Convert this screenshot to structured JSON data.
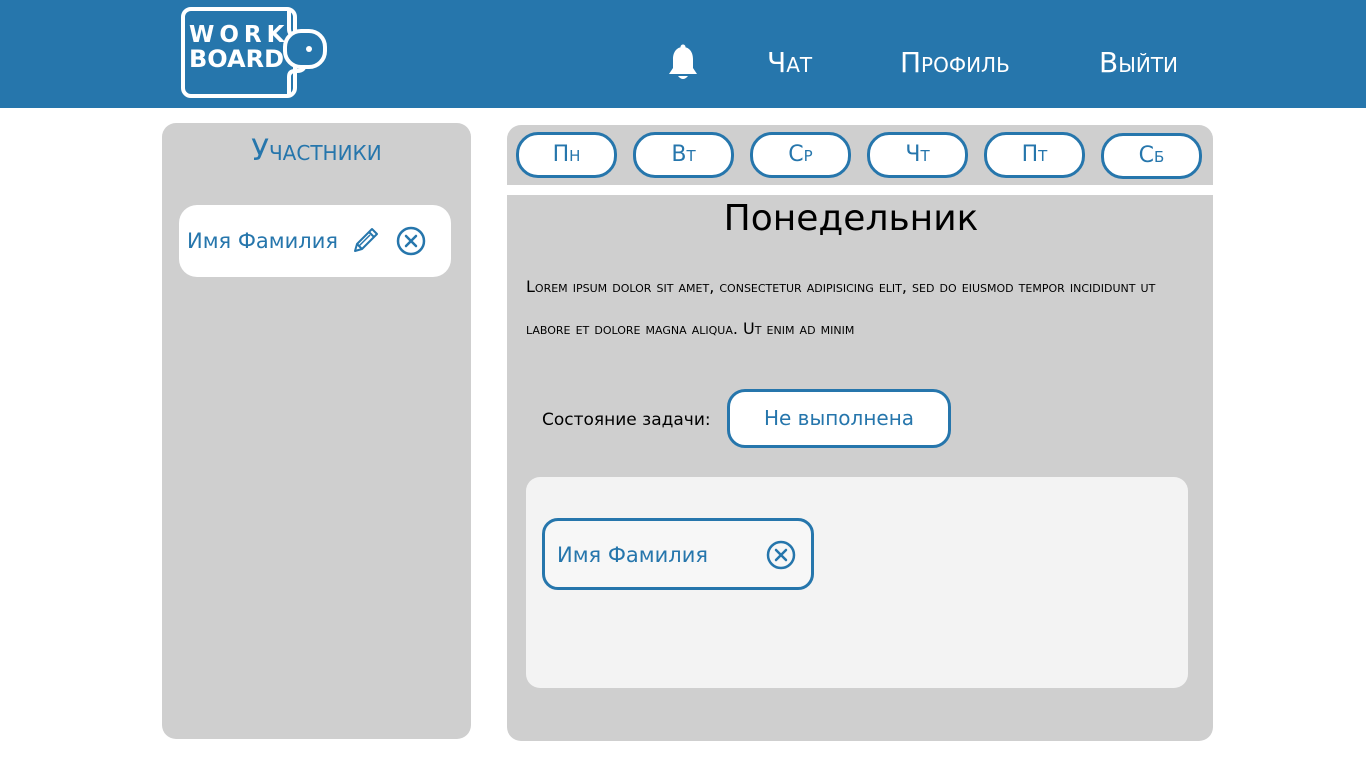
{
  "header": {
    "logo": {
      "line1": "WORK",
      "line2": "BOARD"
    },
    "nav": {
      "chat": "Чат",
      "profile": "Профиль",
      "logout": "Выйти"
    }
  },
  "members": {
    "title": "Участники",
    "items": [
      {
        "name": "Имя Фамилия"
      }
    ]
  },
  "schedule": {
    "days": [
      "Пн",
      "Вт",
      "Ср",
      "Чт",
      "Пт",
      "Сб"
    ],
    "day_title": "Понедельник",
    "description": "Lorem ipsum dolor sit amet, consectetur adipisicing elit, sed do eiusmod tempor incididunt ut labore et dolore magna aliqua. Ut enim ad minim",
    "status_label": "Состояние задачи:",
    "status_value": "Не выполнена",
    "assignees": [
      {
        "name": "Имя Фамилия"
      }
    ]
  },
  "colors": {
    "accent": "#2676ac",
    "panel": "#cfcfcf",
    "box": "#f3f3f3"
  },
  "icons": {
    "bell": "bell-icon",
    "edit": "pencil-icon",
    "remove": "close-circle-icon"
  }
}
